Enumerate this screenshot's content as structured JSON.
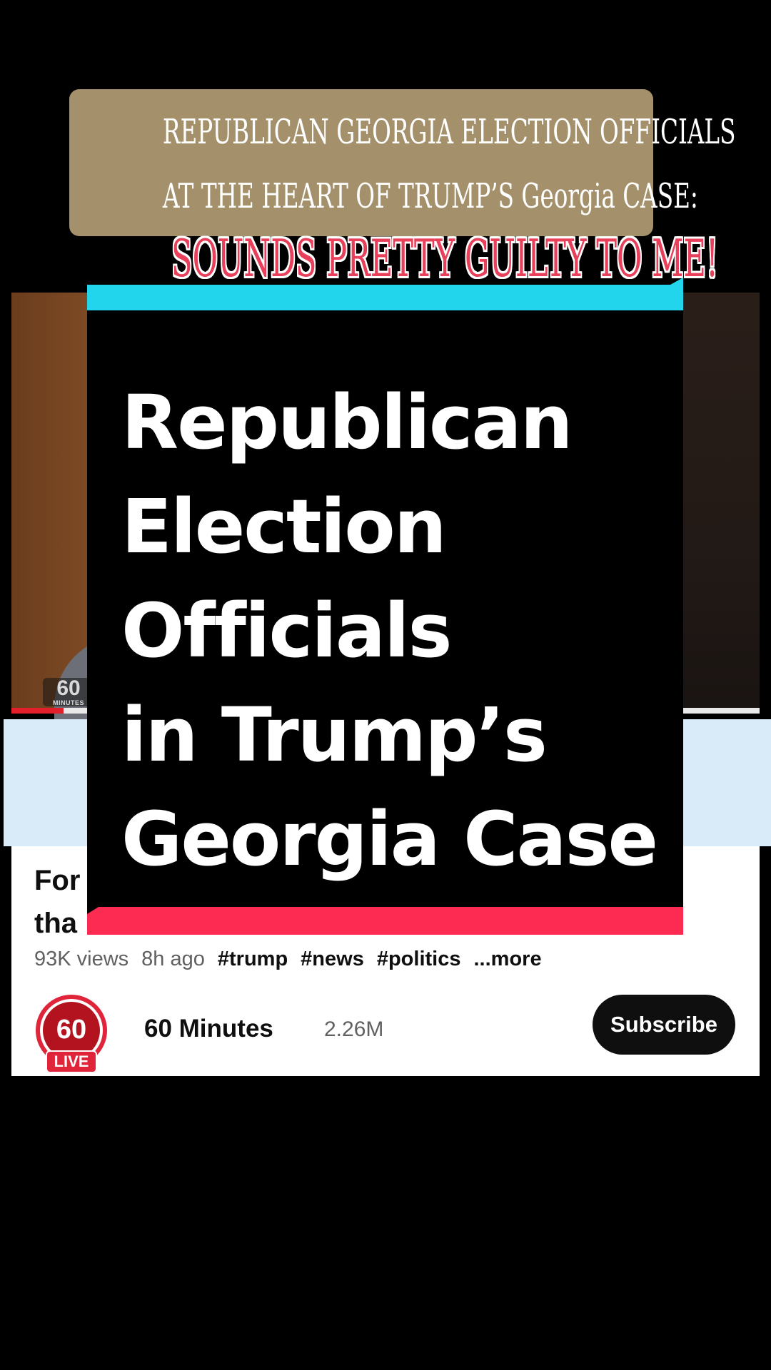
{
  "caption": {
    "line1": "REPUBLICAN GEORGIA ELECTION OFFICIALS",
    "line2": "AT THE HEART OF TRUMP’S Georgia CASE:",
    "highlight": "SOUNDS PRETTY GUILTY TO ME!"
  },
  "card": {
    "title_lines": [
      "Republican",
      "Election",
      "Officials",
      "in Trump’s",
      "Georgia Case"
    ]
  },
  "video": {
    "logo_main": "60",
    "logo_sub": "MINUTES",
    "progress": 0.07,
    "title_line1": "For",
    "title_line2": "tha",
    "title_ellipsis": "..",
    "views": "93K views",
    "age": "8h ago",
    "tags": [
      "#trump",
      "#news",
      "#politics"
    ],
    "more_label": "...more"
  },
  "channel": {
    "avatar_text": "60",
    "live_badge": "LIVE",
    "name": "60 Minutes",
    "subscribers": "2.26M",
    "subscribe_label": "Subscribe"
  },
  "colors": {
    "caption_bg": "#a4916c",
    "highlight_text": "#e8405a",
    "card_top_bar": "#23d5ec",
    "card_bottom_bar": "#fd2b52",
    "band": "#d9ebf9"
  }
}
